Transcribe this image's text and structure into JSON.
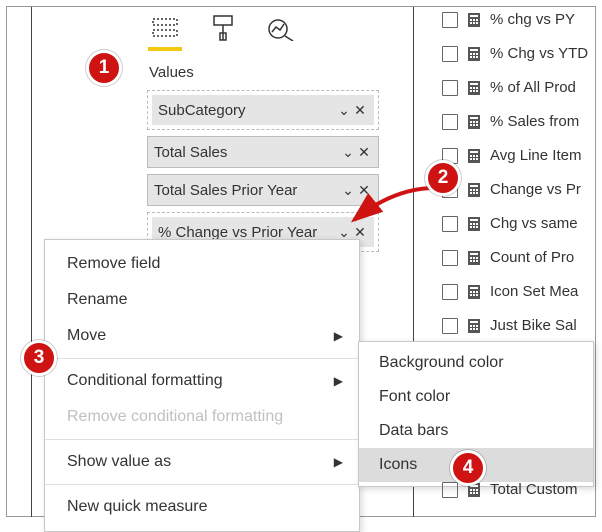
{
  "section_label": "Values",
  "field_well": [
    "SubCategory",
    "Total Sales",
    "Total Sales Prior Year",
    "% Change vs Prior Year"
  ],
  "context_menu": {
    "remove_field": "Remove field",
    "rename": "Rename",
    "move": "Move",
    "conditional_formatting": "Conditional formatting",
    "remove_cf": "Remove conditional formatting",
    "show_value_as": "Show value as",
    "new_quick_measure": "New quick measure"
  },
  "submenu": {
    "background_color": "Background color",
    "font_color": "Font color",
    "data_bars": "Data bars",
    "icons": "Icons"
  },
  "fields": [
    "% chg vs PY",
    "% Chg vs YTD",
    "% of All Prod",
    "% Sales from",
    "Avg Line Item",
    "Change vs Pr",
    "Chg vs same",
    "Count of Pro",
    "Icon Set Mea",
    "Just Bike Sal",
    "Total Custom"
  ],
  "badges": {
    "b1": "1",
    "b2": "2",
    "b3": "3",
    "b4": "4"
  }
}
